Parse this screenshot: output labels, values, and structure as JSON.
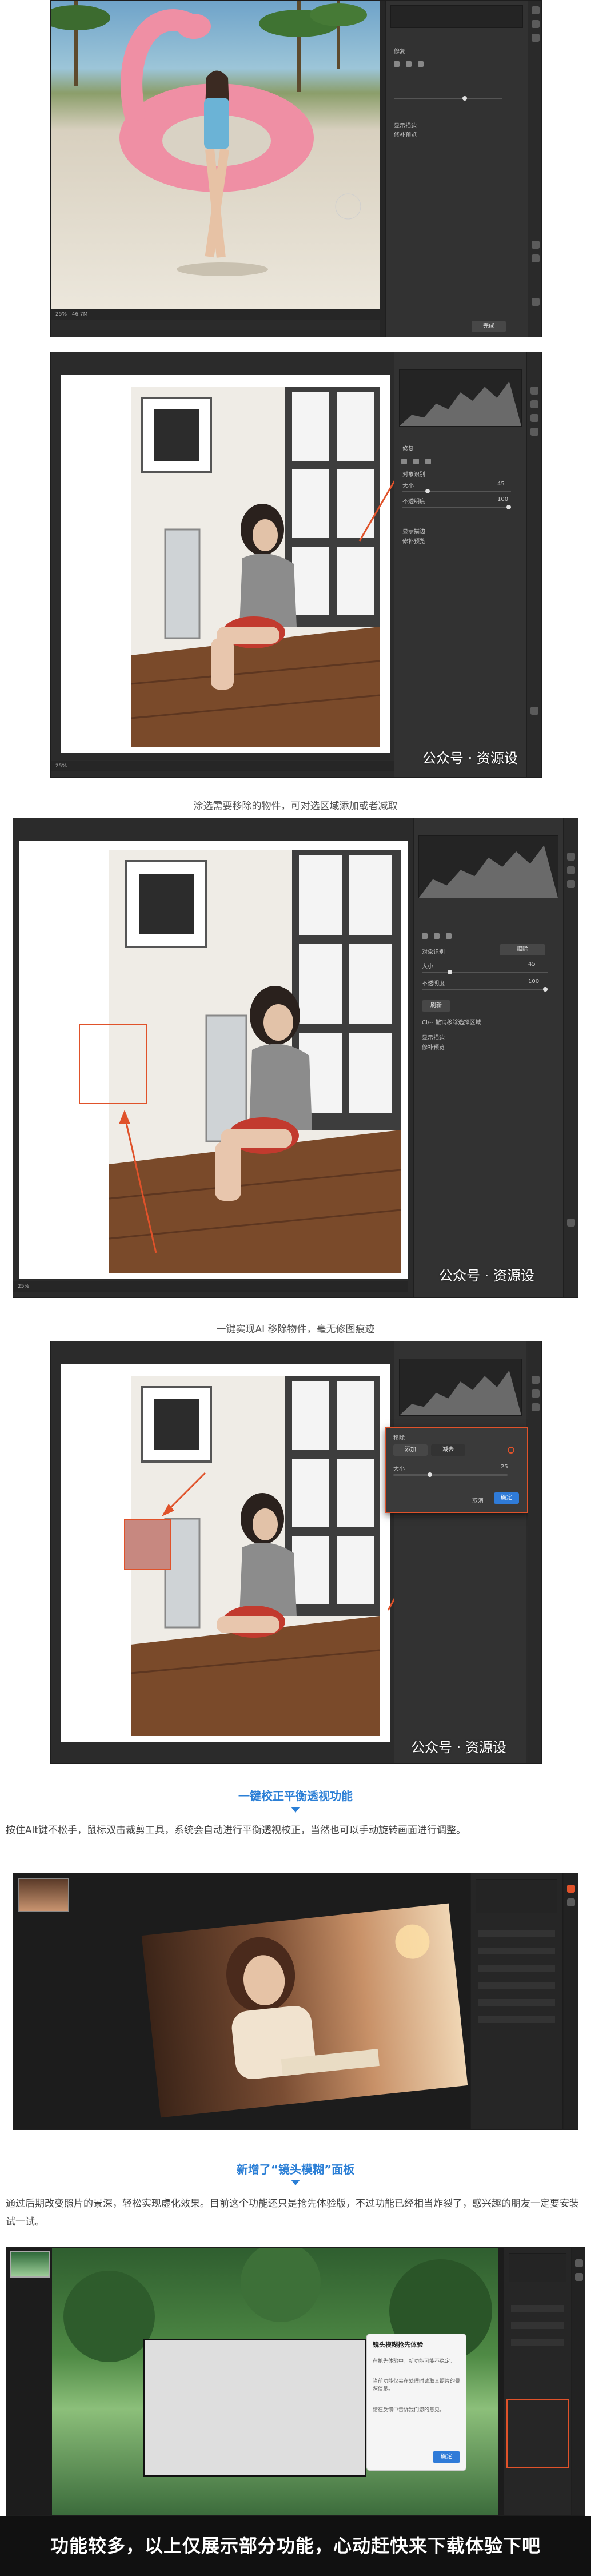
{
  "colors": {
    "accent_orange": "#e0522a",
    "heading_blue": "#2b7fd6",
    "ps_panel": "#323232",
    "ps_canvas": "#2b2b2b",
    "ok_blue": "#2f7bd8"
  },
  "shot1": {
    "status_zoom": "25%",
    "status_size": "46.7M",
    "panel_title": "修复",
    "panel_check1": "显示描边",
    "panel_check2": "修补预览",
    "bottom_btn": "完成",
    "icons": [
      "brush-icon",
      "eraser-icon",
      "person-icon"
    ]
  },
  "shot2": {
    "panel_title": "修复",
    "panel_option1": "对象识别",
    "label_size": "大小",
    "label_hardness": "不透明度",
    "value_size": "45",
    "value_hardness": "100",
    "check1": "显示描边",
    "check2": "修补预览",
    "status_zoom": "25%",
    "watermark": "公众号 · 资源设"
  },
  "caption1": "涂选需要移除的物件，可对选区域添加或者减取",
  "shot3": {
    "panel_option1": "对象识别",
    "panel_btn": "擦除",
    "label_size": "大小",
    "label_hardness": "不透明度",
    "value_size": "45",
    "value_hardness": "100",
    "refresh": "刷新",
    "hint": "Cl/-- 撤销移除选择区域",
    "check1": "显示描边",
    "check2": "修补预览",
    "status_zoom": "25%",
    "watermark": "公众号 · 资源设"
  },
  "caption2": "一键实现AI 移除物件，毫无修图痕迹",
  "shot4": {
    "dialog_title": "移除",
    "mode_a": "添加",
    "mode_b": "减去",
    "size_label": "大小",
    "size_value": "25",
    "cancel": "取消",
    "ok": "确定",
    "watermark": "公众号 · 资源设"
  },
  "heading1": "一键校正平衡透视功能",
  "para1": "按住Alt键不松手，鼠标双击裁剪工具，系统会自动进行平衡透视校正，当然也可以手动旋转画面进行调整。",
  "heading2": "新增了“镜头模糊”面板",
  "para2": "通过后期改变照片的景深，轻松实现虚化效果。目前这个功能还只是抢先体验版，不过功能已经相当炸裂了，感兴趣的朋友一定要安装试一试。",
  "lens_dialog": {
    "title": "镜头模糊抢先体验",
    "line1": "在抢先体验中，新功能可能不稳定。",
    "line2": "当前功能仅会在处理时读取其照片的景深信息。",
    "line3": "请在反馈中告诉我们您的意见。",
    "btn": "确定"
  },
  "banner": "功能较多，以上仅展示部分功能，心动赶快来下载体验下吧"
}
